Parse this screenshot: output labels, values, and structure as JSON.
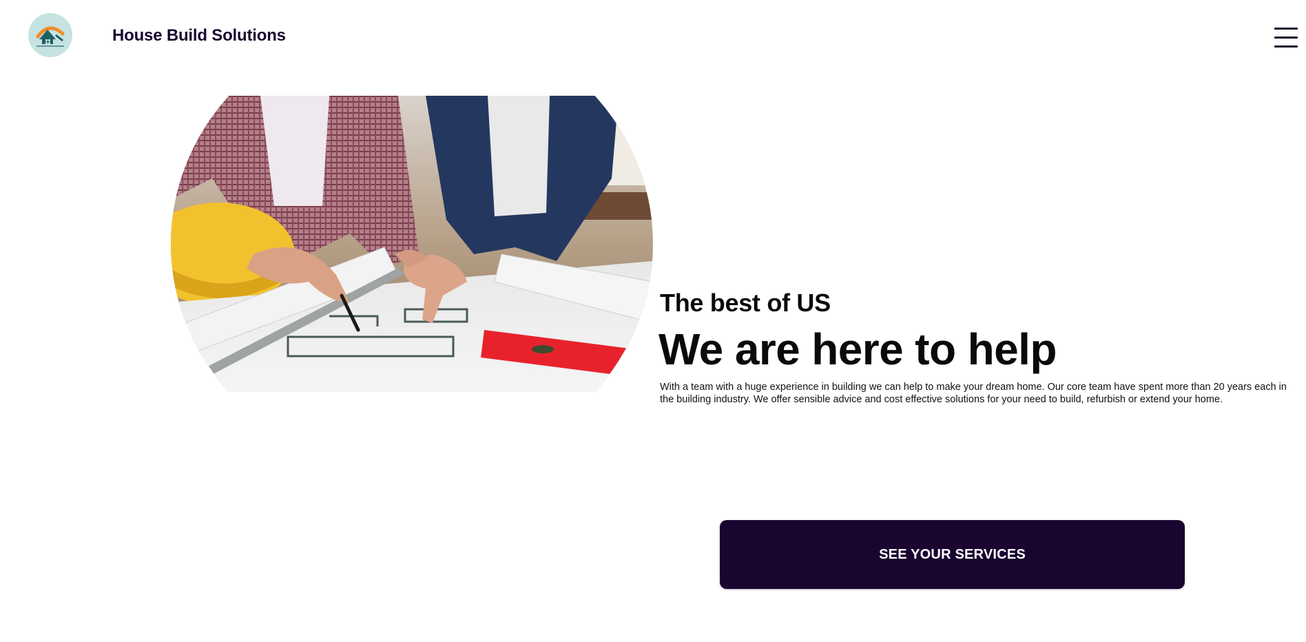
{
  "header": {
    "logo_icon": "house-build-solutions-logo",
    "brand_name": "House Build Solutions",
    "menu_icon": "hamburger-menu-icon"
  },
  "hero": {
    "image_description_icon": "architects-reviewing-blueprints-image",
    "subtitle": "The best of US",
    "headline": "We are here to help",
    "description": "With a team with a huge experience in building we can help to make your dream home. Our core team have spent more than 20 years each in the building industry. We offer sensible advice and cost effective solutions for your need to build, refurbish or extend your home.",
    "cta_label": "SEE YOUR SERVICES"
  },
  "colors": {
    "brand_dark": "#1a0430",
    "logo_bg": "#c6e3e1",
    "logo_orange": "#f28c28",
    "logo_teal": "#1f5f66"
  }
}
